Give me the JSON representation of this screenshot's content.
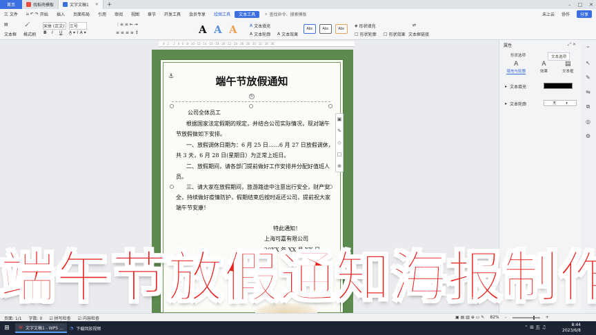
{
  "tabs": {
    "home": "首页",
    "items": [
      {
        "label": "找稻壳模板",
        "icon_color": "#e84c3d"
      },
      {
        "label": "文字文稿1",
        "icon_color": "#3b6ee0"
      }
    ],
    "add": "+"
  },
  "window_controls": {
    "minimize": "–",
    "maximize": "□",
    "close": "✕"
  },
  "menu": {
    "file": "三 文件",
    "items": [
      "开始",
      "插入",
      "页面布局",
      "引用",
      "审阅",
      "视图",
      "章节",
      "开发工具",
      "会员专享"
    ],
    "context_tab": "绘图工具",
    "active_tab": "文本工具",
    "search": "查找命令、搜索模板",
    "cloud": "未上云",
    "collab": "协作",
    "share": "分享"
  },
  "ribbon": {
    "textbox": "文本框",
    "format_painter": "格式刷",
    "font_name": "宋体 (正文)",
    "font_size": "三号",
    "bold": "B",
    "italic": "I",
    "underline": "U",
    "big_a": "A",
    "text_fill": "文本填充",
    "text_outline": "文本轮廓",
    "text_effect": "文本效果",
    "style_label": "Abc",
    "shape_fill": "形状填充",
    "shape_outline": "形状轮廓",
    "shape_effect": "形状效果",
    "textbox_link": "文本框链接"
  },
  "document": {
    "title": "端午节放假通知",
    "greeting": "公司全体员工",
    "p1a": "根据国家法定假期的规定，并结合公司实际情况，现对端午",
    "p1b": "节放假做如下安排。",
    "p2a": "一、放假调休日期为：6 月 25 日……6 月 27 日放假调休，",
    "p2b": "共 3 天，6 月 28 日(星期日）为正常上班日。",
    "p3a": "二、放假期间，请各部门提前做好工作安排并分配好值班人",
    "p3b": "员。",
    "p4a": "三、请大家在放假期间，旅游路途中注意出行安全，财产安",
    "p4b": "全，持续做好疫情防护，假期结束后按时返还公司，提前祝大家",
    "p4c": "端午节安康！",
    "sign1": "特此通知！",
    "sign2": "上海可嘉有限公司",
    "sign3": "20XX 年 XX 月 XX 日"
  },
  "sidebar": {
    "title": "属性",
    "tab1": "形状选项",
    "tab2": "文本选项",
    "sub1": "填充与轮廓",
    "sub2": "效果",
    "sub3": "文本框",
    "fill_label": "文本填充",
    "outline_label": "文本轮廓",
    "outline_value": "无",
    "fill_color": "#000000"
  },
  "status": {
    "page": "页面: 1/1",
    "words": "字数: 0",
    "spell": "拼写检查",
    "content_check": "内容检查",
    "zoom": "82%",
    "zoom_level": 0.82
  },
  "taskbar": {
    "app1": "文字文稿1 - WPS ...",
    "app2": "下载回放视频",
    "time": "8:44",
    "date": "2023/6/8"
  },
  "overlay_title": "端午节放假通知海报制作",
  "colors": {
    "accent": "#3b6ee0",
    "frame_green": "#5d8a4e",
    "overlay_red": "#e8221f"
  }
}
